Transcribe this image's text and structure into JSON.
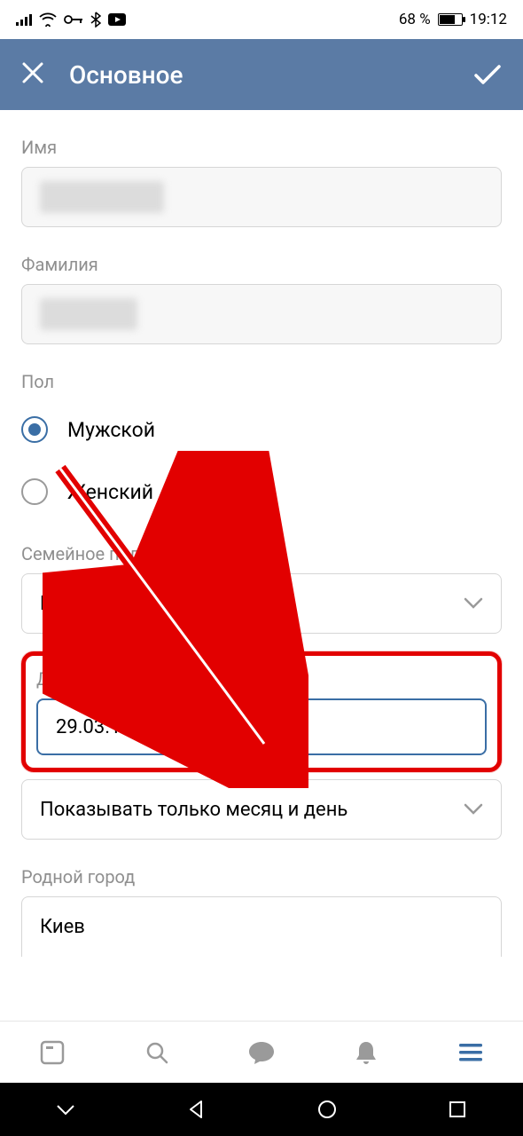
{
  "status": {
    "battery_percent": "68 %",
    "time": "19:12"
  },
  "header": {
    "title": "Основное"
  },
  "form": {
    "name_label": "Имя",
    "surname_label": "Фамилия",
    "gender_label": "Пол",
    "gender_options": {
      "male": "Мужской",
      "female": "Женский"
    },
    "relationship_label": "Семейное положение",
    "relationship_value": "Не указано",
    "dob_label": "Дата рождения",
    "dob_value": "29.03.1992",
    "dob_visibility_value": "Показывать только месяц и день",
    "hometown_label": "Родной город",
    "hometown_value": "Киев"
  }
}
